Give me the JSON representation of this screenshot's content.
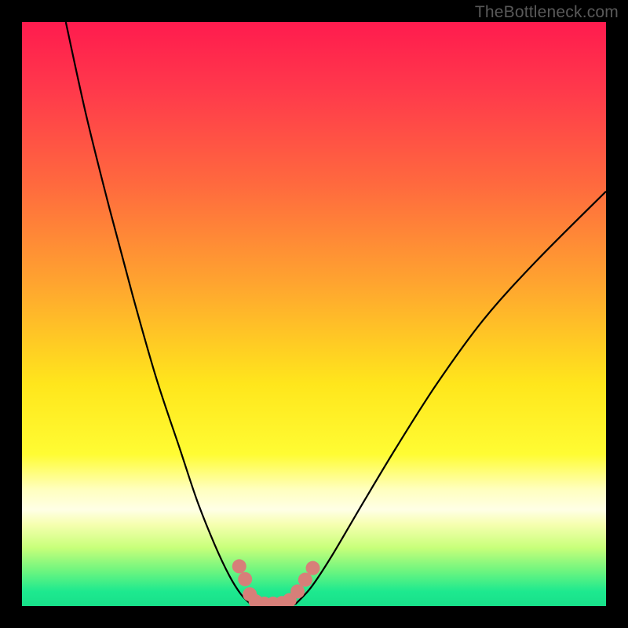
{
  "watermark": {
    "text": "TheBottleneck.com"
  },
  "colors": {
    "background": "#000000",
    "curve": "#000000",
    "marker_fill": "#d77f79",
    "watermark": "#595959",
    "gradient_stops": [
      {
        "offset": 0.0,
        "color": "#ff1b4e"
      },
      {
        "offset": 0.12,
        "color": "#ff3a4b"
      },
      {
        "offset": 0.28,
        "color": "#ff6a3e"
      },
      {
        "offset": 0.45,
        "color": "#ffa52f"
      },
      {
        "offset": 0.62,
        "color": "#ffe61c"
      },
      {
        "offset": 0.74,
        "color": "#fffc33"
      },
      {
        "offset": 0.8,
        "color": "#ffffbe"
      },
      {
        "offset": 0.835,
        "color": "#ffffe6"
      },
      {
        "offset": 0.86,
        "color": "#f6ffb0"
      },
      {
        "offset": 0.9,
        "color": "#c8ff7a"
      },
      {
        "offset": 0.94,
        "color": "#6df57f"
      },
      {
        "offset": 0.975,
        "color": "#1de98f"
      },
      {
        "offset": 1.0,
        "color": "#18e08a"
      }
    ]
  },
  "chart_data": {
    "type": "line",
    "title": "",
    "xlabel": "",
    "ylabel": "",
    "xlim": [
      0,
      100
    ],
    "ylim": [
      0,
      100
    ],
    "note": "Bottleneck-style V-curve. x is relative component balance (0–100); y is bottleneck severity percentage (0 optimal, 100 worst). Values estimated from pixel positions.",
    "series": [
      {
        "name": "left-branch",
        "x": [
          7.5,
          11,
          15,
          19,
          23,
          27,
          30,
          33,
          35.5,
          37.5,
          39.2
        ],
        "y": [
          100,
          84,
          68,
          53,
          39,
          27,
          18,
          10.5,
          5.2,
          2.0,
          0.3
        ]
      },
      {
        "name": "right-branch",
        "x": [
          46.8,
          49.5,
          53,
          58,
          64,
          71,
          79,
          88,
          100
        ],
        "y": [
          0.3,
          3.2,
          8.5,
          17,
          27,
          38,
          49,
          59,
          71
        ]
      },
      {
        "name": "valley-floor",
        "x": [
          39.2,
          40.5,
          42,
          43.5,
          45,
          46.8
        ],
        "y": [
          0.3,
          0.0,
          0.0,
          0.0,
          0.0,
          0.3
        ]
      }
    ],
    "markers": {
      "name": "highlighted-points",
      "points": [
        {
          "x": 37.2,
          "y": 6.8
        },
        {
          "x": 38.2,
          "y": 4.6
        },
        {
          "x": 39.0,
          "y": 2.0
        },
        {
          "x": 40.0,
          "y": 0.8
        },
        {
          "x": 41.5,
          "y": 0.4
        },
        {
          "x": 43.0,
          "y": 0.4
        },
        {
          "x": 44.5,
          "y": 0.5
        },
        {
          "x": 45.8,
          "y": 1.0
        },
        {
          "x": 47.2,
          "y": 2.5
        },
        {
          "x": 48.5,
          "y": 4.5
        },
        {
          "x": 49.8,
          "y": 6.5
        }
      ]
    }
  }
}
